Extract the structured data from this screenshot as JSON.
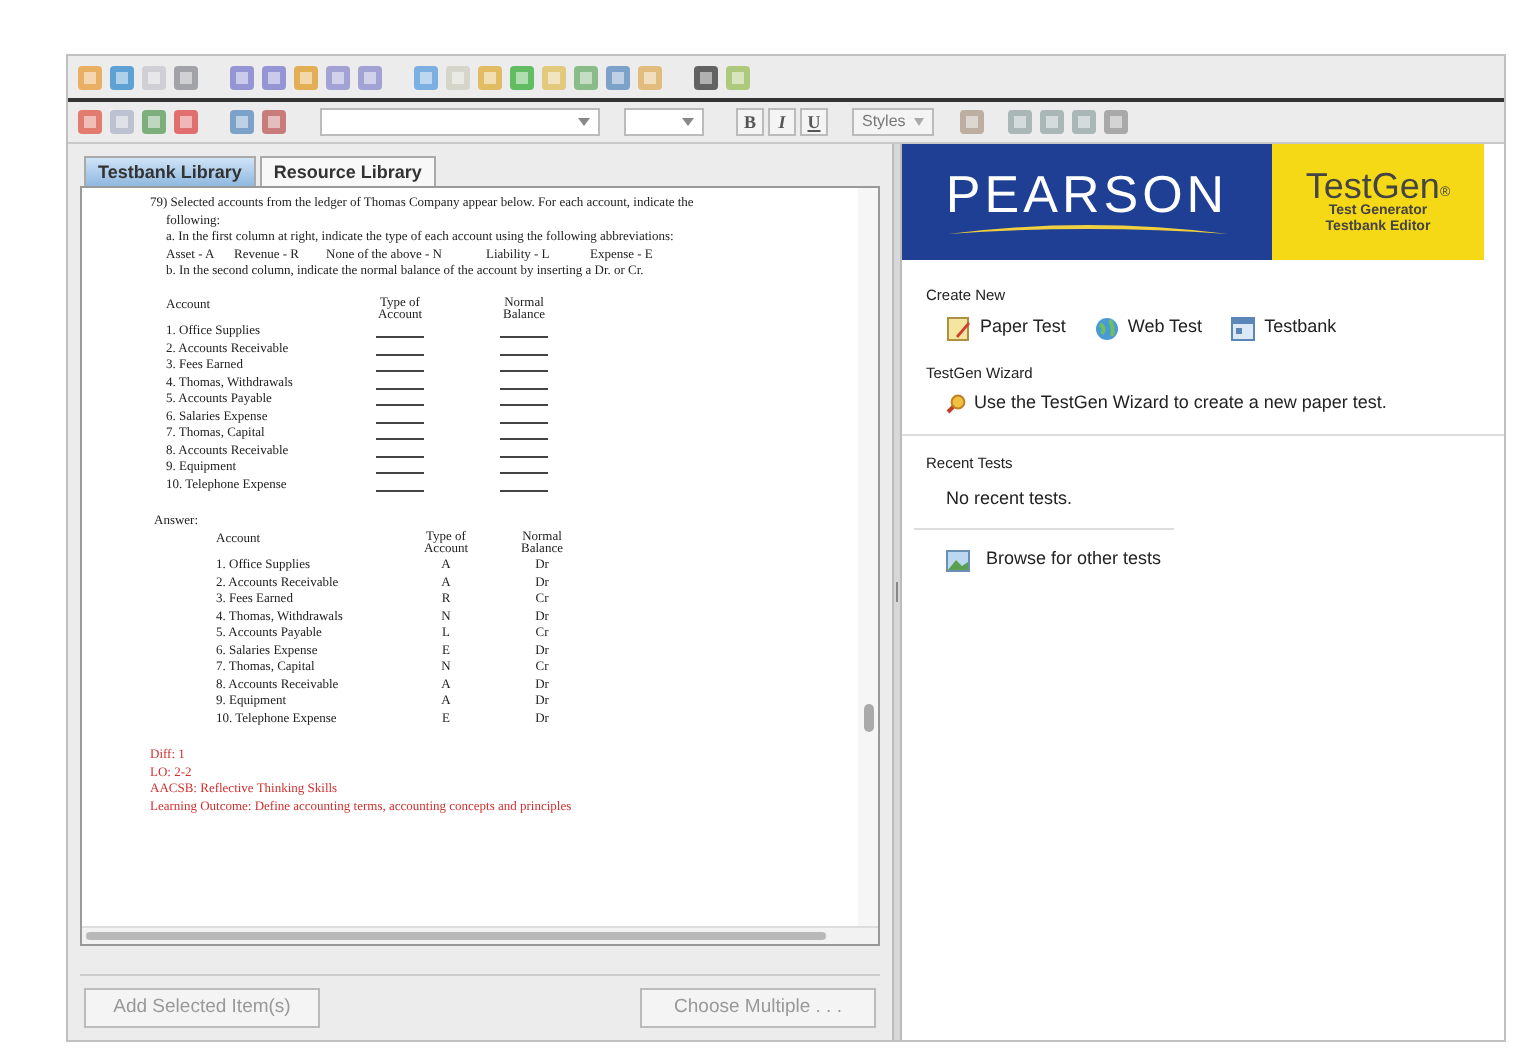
{
  "format_bar": {
    "bold": "B",
    "italic": "I",
    "underline": "U",
    "styles": "Styles"
  },
  "tabs": [
    {
      "label": "Testbank Library",
      "selected": true
    },
    {
      "label": "Resource Library",
      "selected": false
    }
  ],
  "question": {
    "intro_lines": [
      "79) Selected accounts from the ledger of Thomas Company appear below. For each account, indicate the",
      "following:"
    ],
    "part_a": "a. In the first column at right, indicate the type of each account using the following abbreviations:",
    "abbreviations": [
      "Asset - A",
      "Revenue - R",
      "None of the above - N",
      "Liability - L",
      "Expense - E"
    ],
    "part_b": "b. In the second column, indicate the normal balance of the account by inserting a Dr. or Cr.",
    "headers": [
      "Account",
      "Type of Account",
      "Normal Balance"
    ],
    "accounts": [
      "1. Office Supplies",
      "2. Accounts Receivable",
      "3. Fees Earned",
      "4. Thomas, Withdrawals",
      "5. Accounts Payable",
      "6. Salaries Expense",
      "7. Thomas, Capital",
      "8. Accounts Receivable",
      "9. Equipment",
      "10. Telephone Expense"
    ]
  },
  "answer": {
    "label": "Answer:",
    "headers": [
      "Account",
      "Type of Account",
      "Normal Balance"
    ],
    "rows": [
      [
        "1. Office Supplies",
        "A",
        "Dr"
      ],
      [
        "2. Accounts Receivable",
        "A",
        "Dr"
      ],
      [
        "3. Fees Earned",
        "R",
        "Cr"
      ],
      [
        "4. Thomas, Withdrawals",
        "N",
        "Dr"
      ],
      [
        "5. Accounts Payable",
        "L",
        "Cr"
      ],
      [
        "6. Salaries Expense",
        "E",
        "Dr"
      ],
      [
        "7. Thomas, Capital",
        "N",
        "Cr"
      ],
      [
        "8. Accounts Receivable",
        "A",
        "Dr"
      ],
      [
        "9. Equipment",
        "A",
        "Dr"
      ],
      [
        "10. Telephone Expense",
        "E",
        "Dr"
      ]
    ]
  },
  "metadata": [
    "Diff: 1",
    "LO: 2-2",
    "AACSB: Reflective Thinking Skills",
    "Learning Outcome: Define accounting terms, accounting concepts and principles"
  ],
  "buttons": [
    {
      "label": "Add Selected Item(s)",
      "disabled": true
    },
    {
      "label": "Choose Multiple . . .",
      "disabled": true
    }
  ],
  "banner": {
    "publisher": "PEARSON",
    "product": "TestGen",
    "registered": "®",
    "subtitle_lines": [
      "Test Generator",
      "Testbank Editor"
    ]
  },
  "create_new": {
    "title": "Create New",
    "items": [
      {
        "label": "Paper Test",
        "kind": "paper"
      },
      {
        "label": "Web Test",
        "kind": "web"
      },
      {
        "label": "Testbank",
        "kind": "testbank"
      }
    ]
  },
  "wizard": {
    "title": "TestGen Wizard",
    "link": "Use the TestGen Wizard to create a new paper test."
  },
  "recent": {
    "title": "Recent Tests",
    "empty": "No recent tests."
  },
  "browse": "Browse for other tests"
}
